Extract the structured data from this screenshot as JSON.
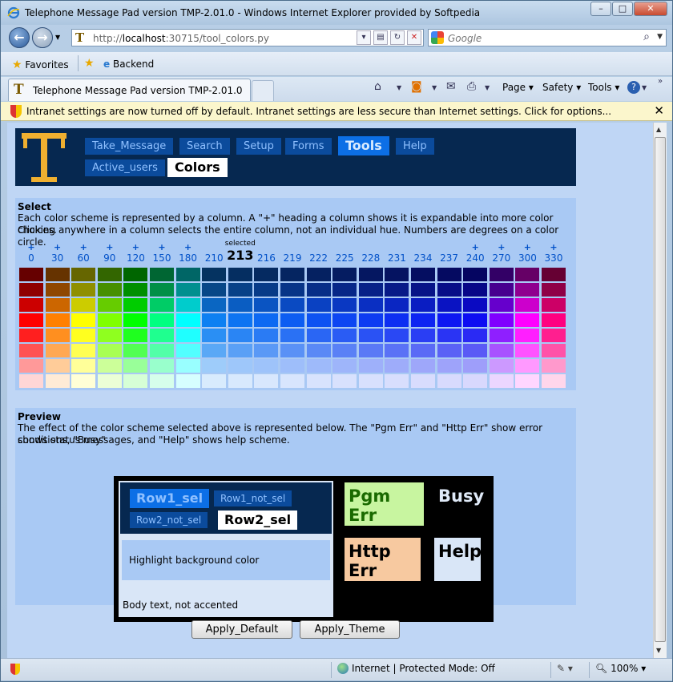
{
  "window": {
    "title": "Telephone Message Pad version TMP-2.01.0 - Windows Internet Explorer provided by Softpedia",
    "minimize": "–",
    "maximize": "□",
    "close": "✕"
  },
  "address": {
    "scheme": "http://",
    "host": "localhost",
    "rest": ":30715/tool_colors.py"
  },
  "search": {
    "placeholder": "Google"
  },
  "favorites": {
    "label": "Favorites",
    "backend": "Backend"
  },
  "tab": {
    "title": "Telephone Message Pad version TMP-2.01.0"
  },
  "commandbar": {
    "page": "Page",
    "safety": "Safety",
    "tools": "Tools"
  },
  "infobar": {
    "message": "Intranet settings are now turned off by default. Intranet settings are less secure than Internet settings. Click for options...",
    "close": "✕"
  },
  "statusbar": {
    "zone": "Internet | Protected Mode: Off",
    "zoom": "100%"
  },
  "nav": {
    "row1": [
      "Take_Message",
      "Search",
      "Setup",
      "Forms",
      "Tools",
      "Help"
    ],
    "row2": [
      "Active_users",
      "Colors"
    ],
    "selected": "Tools",
    "active": "Colors"
  },
  "select": {
    "title": "Select",
    "text1": "Each color scheme is represented by a column. A \"+\" heading a column shows it is expandable into more color choices.",
    "text2": "Clicking anywhere in a column selects the entire column, not an individual hue. Numbers are degrees on a color circle.",
    "selected_label": "selected",
    "selected_hue": "213",
    "plus": "+",
    "columns": [
      {
        "hue": "0",
        "plus": true
      },
      {
        "hue": "30",
        "plus": true
      },
      {
        "hue": "60",
        "plus": true
      },
      {
        "hue": "90",
        "plus": true
      },
      {
        "hue": "120",
        "plus": true
      },
      {
        "hue": "150",
        "plus": true
      },
      {
        "hue": "180",
        "plus": true
      },
      {
        "hue": "210",
        "plus": false
      },
      {
        "hue": "213",
        "plus": false,
        "selected": true
      },
      {
        "hue": "216",
        "plus": false
      },
      {
        "hue": "219",
        "plus": false
      },
      {
        "hue": "222",
        "plus": false
      },
      {
        "hue": "225",
        "plus": false
      },
      {
        "hue": "228",
        "plus": false
      },
      {
        "hue": "231",
        "plus": false
      },
      {
        "hue": "234",
        "plus": false
      },
      {
        "hue": "237",
        "plus": false
      },
      {
        "hue": "240",
        "plus": true
      },
      {
        "hue": "270",
        "plus": true
      },
      {
        "hue": "300",
        "plus": true
      },
      {
        "hue": "330",
        "plus": true
      }
    ]
  },
  "preview": {
    "title": "Preview",
    "text1": "The effect of the color scheme selected above is represented below. The \"Pgm Err\" and \"Http Err\" show error conditions, \"Busy\"",
    "text2": "shows status messages, and \"Help\" shows help scheme.",
    "row1_sel": "Row1_sel",
    "row1_not_sel": "Row1_not_sel",
    "row2_not_sel": "Row2_not_sel",
    "row2_sel": "Row2_sel",
    "highlight": "Highlight background color",
    "body_text": "Body text, not accented",
    "pgm_err": "Pgm Err",
    "busy": "Busy",
    "http_err": "Http Err",
    "help": "Help"
  },
  "buttons": {
    "apply_default": "Apply_Default",
    "apply_theme": "Apply_Theme"
  },
  "colors": {
    "header_bg": "#062850",
    "menu_bg": "#0b4b9c",
    "menu_sel": "#0c6fe6",
    "panel_bg": "#a9c9f4",
    "page_bg": "#bfd6f5",
    "pgm_err_bg": "#c8f5a0",
    "http_err_bg": "#f7c9a0",
    "help_bg": "#d9e6f7"
  }
}
